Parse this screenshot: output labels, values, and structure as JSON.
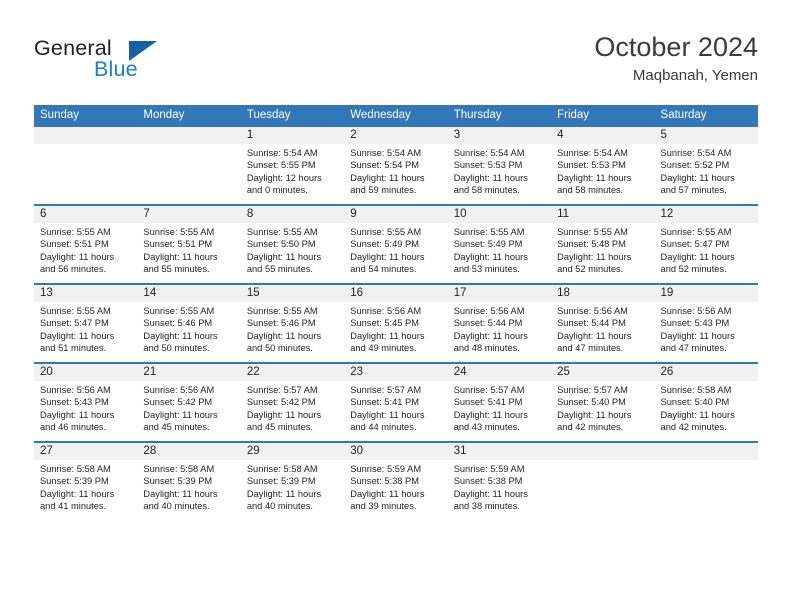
{
  "brand": {
    "name_part1": "General",
    "name_part2": "Blue",
    "accent_color": "#1b7fd4",
    "triangle_color": "#1461a8"
  },
  "header": {
    "title": "October 2024",
    "subtitle": "Maqbanah, Yemen"
  },
  "theme": {
    "header_row_color": "#3277b8",
    "day_band_color": "#f1f1f1",
    "text_color": "#231f20"
  },
  "weekday_headers": [
    "Sunday",
    "Monday",
    "Tuesday",
    "Wednesday",
    "Thursday",
    "Friday",
    "Saturday"
  ],
  "weeks": [
    [
      {
        "day": "",
        "sunrise": "",
        "sunset": "",
        "daylight1": "",
        "daylight2": ""
      },
      {
        "day": "",
        "sunrise": "",
        "sunset": "",
        "daylight1": "",
        "daylight2": ""
      },
      {
        "day": "1",
        "sunrise": "Sunrise: 5:54 AM",
        "sunset": "Sunset: 5:55 PM",
        "daylight1": "Daylight: 12 hours",
        "daylight2": "and 0 minutes."
      },
      {
        "day": "2",
        "sunrise": "Sunrise: 5:54 AM",
        "sunset": "Sunset: 5:54 PM",
        "daylight1": "Daylight: 11 hours",
        "daylight2": "and 59 minutes."
      },
      {
        "day": "3",
        "sunrise": "Sunrise: 5:54 AM",
        "sunset": "Sunset: 5:53 PM",
        "daylight1": "Daylight: 11 hours",
        "daylight2": "and 58 minutes."
      },
      {
        "day": "4",
        "sunrise": "Sunrise: 5:54 AM",
        "sunset": "Sunset: 5:53 PM",
        "daylight1": "Daylight: 11 hours",
        "daylight2": "and 58 minutes."
      },
      {
        "day": "5",
        "sunrise": "Sunrise: 5:54 AM",
        "sunset": "Sunset: 5:52 PM",
        "daylight1": "Daylight: 11 hours",
        "daylight2": "and 57 minutes."
      }
    ],
    [
      {
        "day": "6",
        "sunrise": "Sunrise: 5:55 AM",
        "sunset": "Sunset: 5:51 PM",
        "daylight1": "Daylight: 11 hours",
        "daylight2": "and 56 minutes."
      },
      {
        "day": "7",
        "sunrise": "Sunrise: 5:55 AM",
        "sunset": "Sunset: 5:51 PM",
        "daylight1": "Daylight: 11 hours",
        "daylight2": "and 55 minutes."
      },
      {
        "day": "8",
        "sunrise": "Sunrise: 5:55 AM",
        "sunset": "Sunset: 5:50 PM",
        "daylight1": "Daylight: 11 hours",
        "daylight2": "and 55 minutes."
      },
      {
        "day": "9",
        "sunrise": "Sunrise: 5:55 AM",
        "sunset": "Sunset: 5:49 PM",
        "daylight1": "Daylight: 11 hours",
        "daylight2": "and 54 minutes."
      },
      {
        "day": "10",
        "sunrise": "Sunrise: 5:55 AM",
        "sunset": "Sunset: 5:49 PM",
        "daylight1": "Daylight: 11 hours",
        "daylight2": "and 53 minutes."
      },
      {
        "day": "11",
        "sunrise": "Sunrise: 5:55 AM",
        "sunset": "Sunset: 5:48 PM",
        "daylight1": "Daylight: 11 hours",
        "daylight2": "and 52 minutes."
      },
      {
        "day": "12",
        "sunrise": "Sunrise: 5:55 AM",
        "sunset": "Sunset: 5:47 PM",
        "daylight1": "Daylight: 11 hours",
        "daylight2": "and 52 minutes."
      }
    ],
    [
      {
        "day": "13",
        "sunrise": "Sunrise: 5:55 AM",
        "sunset": "Sunset: 5:47 PM",
        "daylight1": "Daylight: 11 hours",
        "daylight2": "and 51 minutes."
      },
      {
        "day": "14",
        "sunrise": "Sunrise: 5:55 AM",
        "sunset": "Sunset: 5:46 PM",
        "daylight1": "Daylight: 11 hours",
        "daylight2": "and 50 minutes."
      },
      {
        "day": "15",
        "sunrise": "Sunrise: 5:55 AM",
        "sunset": "Sunset: 5:46 PM",
        "daylight1": "Daylight: 11 hours",
        "daylight2": "and 50 minutes."
      },
      {
        "day": "16",
        "sunrise": "Sunrise: 5:56 AM",
        "sunset": "Sunset: 5:45 PM",
        "daylight1": "Daylight: 11 hours",
        "daylight2": "and 49 minutes."
      },
      {
        "day": "17",
        "sunrise": "Sunrise: 5:56 AM",
        "sunset": "Sunset: 5:44 PM",
        "daylight1": "Daylight: 11 hours",
        "daylight2": "and 48 minutes."
      },
      {
        "day": "18",
        "sunrise": "Sunrise: 5:56 AM",
        "sunset": "Sunset: 5:44 PM",
        "daylight1": "Daylight: 11 hours",
        "daylight2": "and 47 minutes."
      },
      {
        "day": "19",
        "sunrise": "Sunrise: 5:56 AM",
        "sunset": "Sunset: 5:43 PM",
        "daylight1": "Daylight: 11 hours",
        "daylight2": "and 47 minutes."
      }
    ],
    [
      {
        "day": "20",
        "sunrise": "Sunrise: 5:56 AM",
        "sunset": "Sunset: 5:43 PM",
        "daylight1": "Daylight: 11 hours",
        "daylight2": "and 46 minutes."
      },
      {
        "day": "21",
        "sunrise": "Sunrise: 5:56 AM",
        "sunset": "Sunset: 5:42 PM",
        "daylight1": "Daylight: 11 hours",
        "daylight2": "and 45 minutes."
      },
      {
        "day": "22",
        "sunrise": "Sunrise: 5:57 AM",
        "sunset": "Sunset: 5:42 PM",
        "daylight1": "Daylight: 11 hours",
        "daylight2": "and 45 minutes."
      },
      {
        "day": "23",
        "sunrise": "Sunrise: 5:57 AM",
        "sunset": "Sunset: 5:41 PM",
        "daylight1": "Daylight: 11 hours",
        "daylight2": "and 44 minutes."
      },
      {
        "day": "24",
        "sunrise": "Sunrise: 5:57 AM",
        "sunset": "Sunset: 5:41 PM",
        "daylight1": "Daylight: 11 hours",
        "daylight2": "and 43 minutes."
      },
      {
        "day": "25",
        "sunrise": "Sunrise: 5:57 AM",
        "sunset": "Sunset: 5:40 PM",
        "daylight1": "Daylight: 11 hours",
        "daylight2": "and 42 minutes."
      },
      {
        "day": "26",
        "sunrise": "Sunrise: 5:58 AM",
        "sunset": "Sunset: 5:40 PM",
        "daylight1": "Daylight: 11 hours",
        "daylight2": "and 42 minutes."
      }
    ],
    [
      {
        "day": "27",
        "sunrise": "Sunrise: 5:58 AM",
        "sunset": "Sunset: 5:39 PM",
        "daylight1": "Daylight: 11 hours",
        "daylight2": "and 41 minutes."
      },
      {
        "day": "28",
        "sunrise": "Sunrise: 5:58 AM",
        "sunset": "Sunset: 5:39 PM",
        "daylight1": "Daylight: 11 hours",
        "daylight2": "and 40 minutes."
      },
      {
        "day": "29",
        "sunrise": "Sunrise: 5:58 AM",
        "sunset": "Sunset: 5:39 PM",
        "daylight1": "Daylight: 11 hours",
        "daylight2": "and 40 minutes."
      },
      {
        "day": "30",
        "sunrise": "Sunrise: 5:59 AM",
        "sunset": "Sunset: 5:38 PM",
        "daylight1": "Daylight: 11 hours",
        "daylight2": "and 39 minutes."
      },
      {
        "day": "31",
        "sunrise": "Sunrise: 5:59 AM",
        "sunset": "Sunset: 5:38 PM",
        "daylight1": "Daylight: 11 hours",
        "daylight2": "and 38 minutes."
      },
      {
        "day": "",
        "sunrise": "",
        "sunset": "",
        "daylight1": "",
        "daylight2": ""
      },
      {
        "day": "",
        "sunrise": "",
        "sunset": "",
        "daylight1": "",
        "daylight2": ""
      }
    ]
  ]
}
